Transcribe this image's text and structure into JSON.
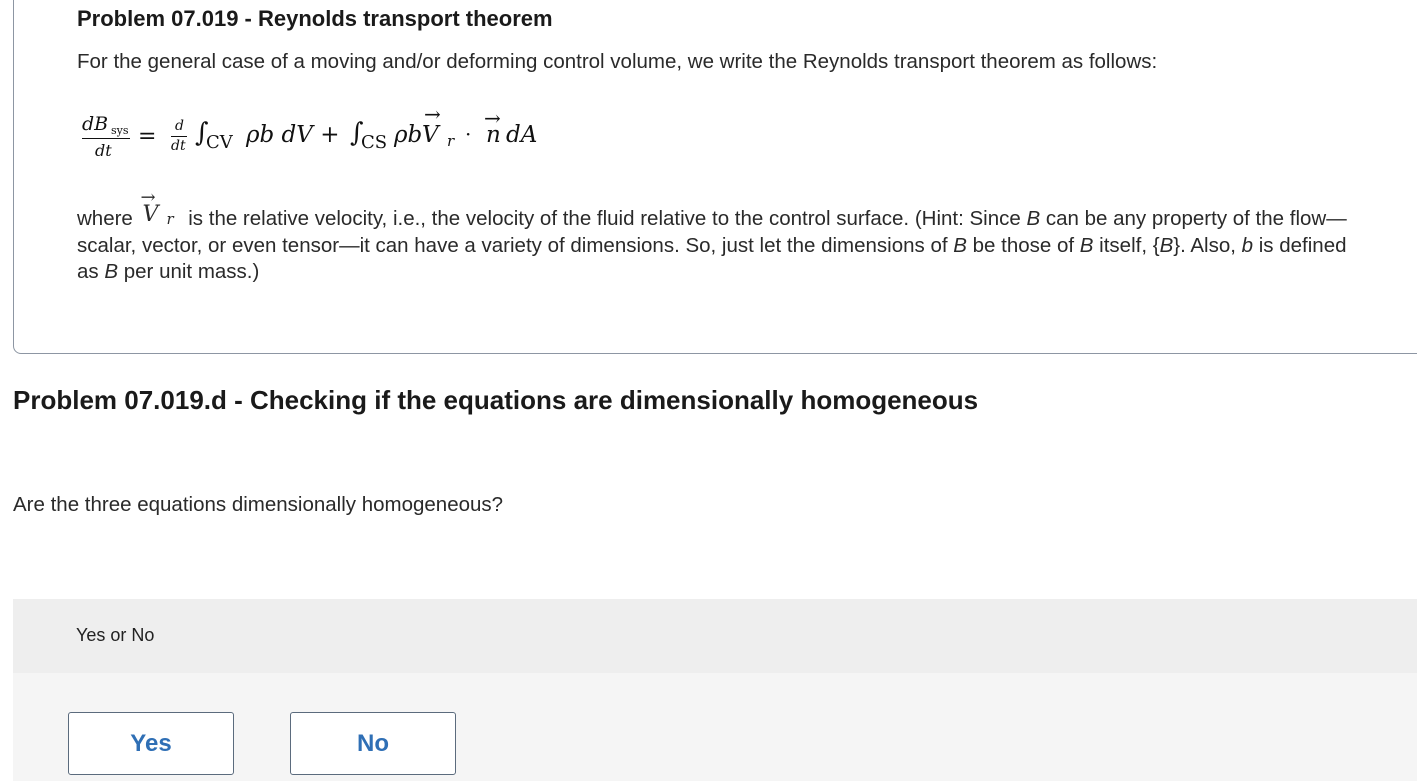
{
  "problem": {
    "title": "Problem 07.019 - Reynolds transport theorem",
    "intro": "For the general case of a moving and/or deforming control volume, we write the Reynolds transport theorem as follows:",
    "equation": {
      "lhs_numerator": "dB",
      "lhs_sub": "sys",
      "lhs_denominator": "dt",
      "equals": "=",
      "d_num": "d",
      "d_den": "dt",
      "integral": "∫",
      "cv_sub": "CV",
      "cv_integrand": "ρb dV +",
      "cs_sub": "CS",
      "cs_integrand": "ρb",
      "vector": "V",
      "r_sub": "r",
      "dot": "·",
      "normal": "n",
      "area": "dA",
      "arrow": "→"
    },
    "where": {
      "lead": "where",
      "sym_V": "V",
      "sym_r": "r",
      "arrow": "→",
      "p1": " is the relative velocity, i.e., the velocity of the fluid relative to the control surface. (Hint: Since ",
      "B1": "B",
      "p2": " can be any property of the flow—scalar, vector, or even tensor—it can have a variety of dimensions. So, just let the dimensions of ",
      "B2": "B",
      "p3": " be those of ",
      "B3": "B",
      "p4": " itself, {",
      "B4": "B",
      "p5": "}. Also, ",
      "b1": "b",
      "p6": " is defined as ",
      "B5": "B",
      "p7": " per unit mass.)"
    }
  },
  "section": {
    "title": "Problem 07.019.d - Checking if the equations are dimensionally homogeneous",
    "question": "Are the three equations dimensionally homogeneous?"
  },
  "answer": {
    "label": "Yes or No",
    "yes_label": "Yes",
    "no_label": "No"
  },
  "colors": {
    "button_text": "#2f6fb5",
    "panel_bg": "#f2f2f2",
    "box_border": "#8d96a3"
  }
}
